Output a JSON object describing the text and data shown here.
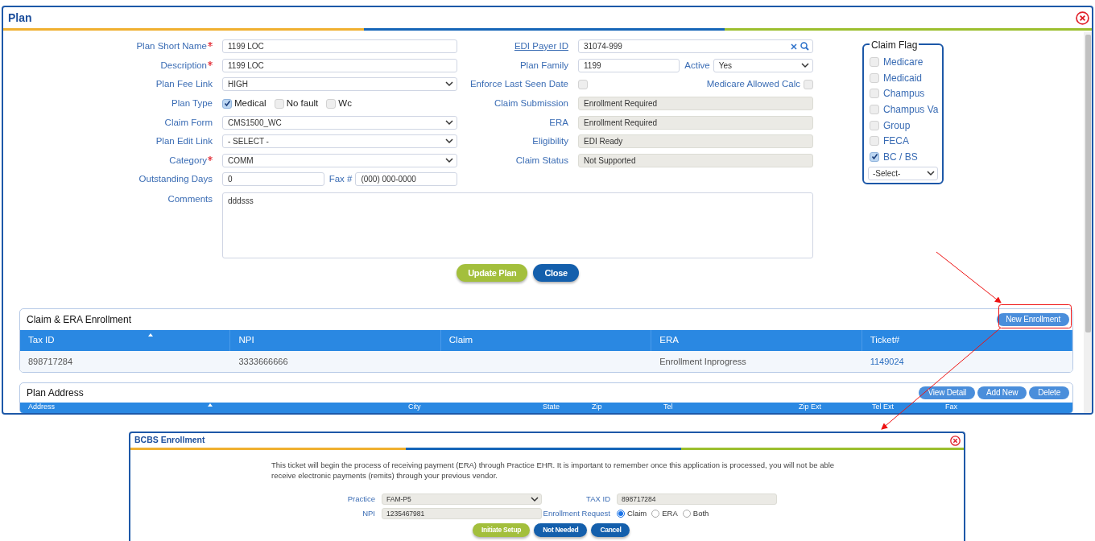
{
  "window": {
    "title": "Plan"
  },
  "plan_form": {
    "rows": [
      {
        "left": [
          {
            "kind": "label",
            "text": "Plan Short Name",
            "required": true
          },
          {
            "kind": "text",
            "value": "1199 LOC"
          }
        ],
        "right": [
          {
            "kind": "link",
            "text": "EDI Payer ID"
          },
          {
            "kind": "search",
            "value": "31074-999"
          }
        ]
      },
      {
        "left": [
          {
            "kind": "label",
            "text": "Description",
            "required": true
          },
          {
            "kind": "text",
            "value": "1199 LOC"
          }
        ],
        "right": [
          {
            "kind": "label",
            "text": "Plan Family"
          },
          {
            "kind": "text",
            "value": "1199"
          },
          {
            "kind": "label",
            "text": "Active"
          },
          {
            "kind": "select",
            "value": "Yes"
          }
        ]
      },
      {
        "left": [
          {
            "kind": "label",
            "text": "Plan Fee Link"
          },
          {
            "kind": "select",
            "value": "HIGH"
          }
        ],
        "right": [
          {
            "kind": "label",
            "text": "Enforce Last Seen Date"
          },
          {
            "kind": "checkbox",
            "checked": false
          },
          {
            "kind": "label",
            "text": "Medicare Allowed Calc"
          },
          {
            "kind": "checkbox",
            "checked": false
          }
        ]
      },
      {
        "left": [
          {
            "kind": "label",
            "text": "Plan Type"
          },
          {
            "kind": "option",
            "text": "Medical",
            "checked": true
          },
          {
            "kind": "option",
            "text": "No fault",
            "checked": false
          },
          {
            "kind": "option",
            "text": "Wc",
            "checked": false
          }
        ],
        "right": [
          {
            "kind": "label",
            "text": "Claim Submission"
          },
          {
            "kind": "readonly",
            "value": "Enrollment Required"
          }
        ]
      },
      {
        "left": [
          {
            "kind": "label",
            "text": "Claim Form"
          },
          {
            "kind": "select",
            "value": "CMS1500_WC"
          }
        ],
        "right": [
          {
            "kind": "label",
            "text": "ERA"
          },
          {
            "kind": "readonly",
            "value": "Enrollment Required"
          }
        ]
      },
      {
        "left": [
          {
            "kind": "label",
            "text": "Plan Edit Link"
          },
          {
            "kind": "select",
            "value": "- SELECT -"
          }
        ],
        "right": [
          {
            "kind": "label",
            "text": "Eligibility"
          },
          {
            "kind": "readonly",
            "value": "EDI Ready"
          }
        ]
      },
      {
        "left": [
          {
            "kind": "label",
            "text": "Category",
            "required": true
          },
          {
            "kind": "select",
            "value": "COMM"
          }
        ],
        "right": [
          {
            "kind": "label",
            "text": "Claim Status"
          },
          {
            "kind": "readonly",
            "value": "Not Supported"
          }
        ]
      },
      {
        "left": [
          {
            "kind": "label",
            "text": "Outstanding Days"
          },
          {
            "kind": "text",
            "value": "0"
          },
          {
            "kind": "label",
            "text": "Fax #"
          },
          {
            "kind": "text",
            "value": "(000) 000-0000"
          }
        ],
        "right": []
      },
      {
        "left": [
          {
            "kind": "label",
            "text": "Comments"
          },
          {
            "kind": "textarea",
            "value": "dddsss"
          }
        ],
        "right": []
      }
    ],
    "buttons": [
      {
        "label": "Update Plan",
        "kind": "confirm"
      },
      {
        "label": "Close",
        "kind": "dismiss"
      }
    ]
  },
  "claim_flag": {
    "legend": "Claim Flag",
    "options": [
      {
        "label": "Medicare",
        "checked": false
      },
      {
        "label": "Medicaid",
        "checked": false
      },
      {
        "label": "Champus",
        "checked": false
      },
      {
        "label": "Champus Va",
        "checked": false
      },
      {
        "label": "Group",
        "checked": false
      },
      {
        "label": "FECA",
        "checked": false
      },
      {
        "label": "BC / BS",
        "checked": true
      }
    ],
    "select": "-Select-"
  },
  "enrollment_panel": {
    "title": "Claim & ERA Enrollment",
    "buttons": [
      {
        "label": "New Enrollment",
        "kind": "small"
      }
    ],
    "columns": [
      "Tax ID",
      "NPI",
      "Claim",
      "ERA",
      "Ticket#"
    ],
    "rows": [
      {
        "tax_id": "898717284",
        "npi": "3333666666",
        "era": "Enrollment Inprogress",
        "ticket": "1149024"
      }
    ]
  },
  "address_panel": {
    "title": "Plan Address",
    "buttons": [
      {
        "label": "View Detail",
        "kind": "small"
      },
      {
        "label": "Add New",
        "kind": "small"
      },
      {
        "label": "Delete",
        "kind": "small"
      }
    ],
    "columns": [
      "Address",
      "City",
      "State",
      "Zip",
      "Tel",
      "Zip Ext",
      "Tel Ext",
      "Fax"
    ]
  },
  "bcbs_dialog": {
    "title": "BCBS Enrollment",
    "message": "This ticket will begin the process of receiving payment (ERA) through Practice EHR. It is important to remember once this application is processed, you will not be able receive electronic payments (remits) through your previous vendor.",
    "practice": {
      "label": "Practice",
      "value": "FAM-P5"
    },
    "tax_id": {
      "label": "TAX ID",
      "value": "898717284"
    },
    "npi": {
      "label": "NPI",
      "value": "1235467981"
    },
    "enrollment_request": {
      "label": "Enrollment Request",
      "options": [
        {
          "label": "Claim",
          "selected": true
        },
        {
          "label": "ERA",
          "selected": false
        },
        {
          "label": "Both",
          "selected": false
        }
      ]
    },
    "buttons": [
      {
        "label": "Initiate Setup",
        "kind": "confirm"
      },
      {
        "label": "Not Needed",
        "kind": "dismiss"
      },
      {
        "label": "Cancel",
        "kind": "dismiss"
      }
    ]
  }
}
